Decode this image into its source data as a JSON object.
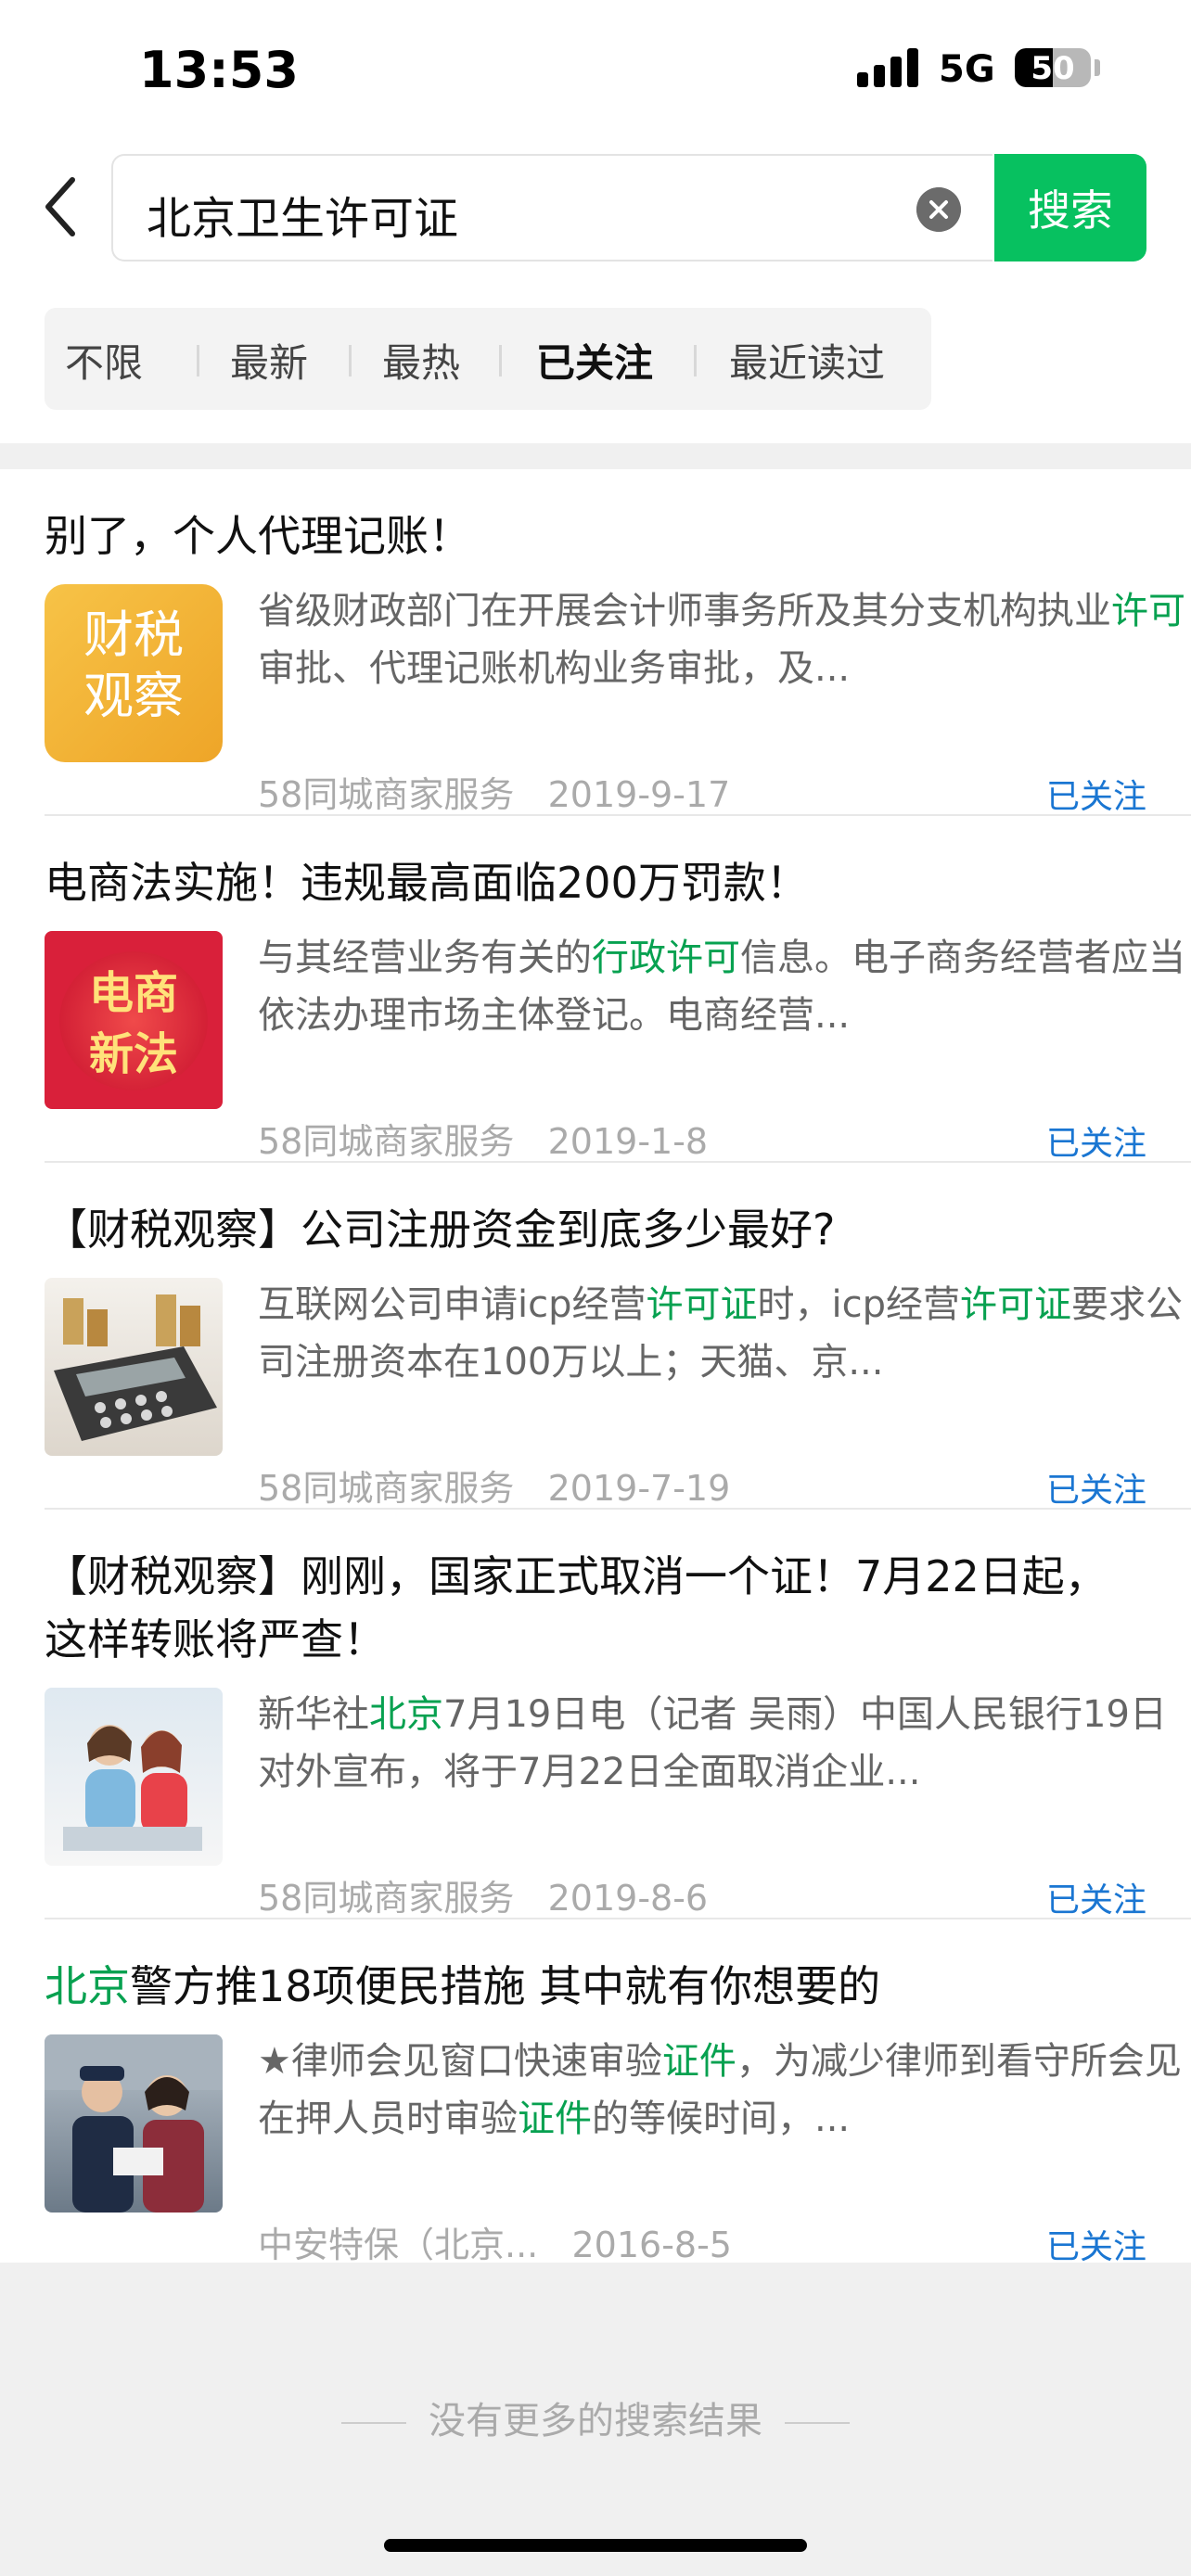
{
  "status_bar": {
    "time": "13:53",
    "network": "5G",
    "battery": "50",
    "battery_level": 0.5
  },
  "search": {
    "query": "北京卫生许可证",
    "button_label": "搜索"
  },
  "filters": [
    "不限",
    "最新",
    "最热",
    "已关注",
    "最近读过"
  ],
  "active_filter": "已关注",
  "results": [
    {
      "title_parts": [
        {
          "text": "别了，个人代理记账！",
          "hl": false
        }
      ],
      "thumb_text": [
        "财税",
        "观察"
      ],
      "snippet_parts": [
        {
          "text": "省级财政部门在开展会计师事务所及其分支机构执业",
          "hl": false
        },
        {
          "text": "许可",
          "hl": true
        },
        {
          "text": "审批、代理记账机构业务审批，及...",
          "hl": false
        }
      ],
      "source": "58同城商家服务",
      "date": "2019-9-17",
      "follow_label": "已关注"
    },
    {
      "title_parts": [
        {
          "text": "电商法实施！违规最高面临200万罚款！",
          "hl": false
        }
      ],
      "thumb_text": [
        "电商",
        "新法"
      ],
      "snippet_parts": [
        {
          "text": "与其经营业务有关的",
          "hl": false
        },
        {
          "text": "行政许可",
          "hl": true
        },
        {
          "text": "信息。电子商务经营者应当依法办理市场主体登记。电商经营...",
          "hl": false
        }
      ],
      "source": "58同城商家服务",
      "date": "2019-1-8",
      "follow_label": "已关注"
    },
    {
      "title_parts": [
        {
          "text": "【财税观察】公司注册资金到底多少最好?",
          "hl": false
        }
      ],
      "thumb_text": [],
      "snippet_parts": [
        {
          "text": "互联网公司申请icp经营",
          "hl": false
        },
        {
          "text": "许可证",
          "hl": true
        },
        {
          "text": "时，icp经营",
          "hl": false
        },
        {
          "text": "许可证",
          "hl": true
        },
        {
          "text": "要求公司注册资本在100万以上；天猫、京...",
          "hl": false
        }
      ],
      "source": "58同城商家服务",
      "date": "2019-7-19",
      "follow_label": "已关注"
    },
    {
      "title_parts": [
        {
          "text": "【财税观察】刚刚，国家正式取消一个证！7月22日起，这样转账将严查！",
          "hl": false
        }
      ],
      "thumb_text": [],
      "snippet_parts": [
        {
          "text": "新华社",
          "hl": false
        },
        {
          "text": "北京",
          "hl": true
        },
        {
          "text": "7月19日电（记者 吴雨）中国人民银行19日对外宣布，将于7月22日全面取消企业...",
          "hl": false
        }
      ],
      "source": "58同城商家服务",
      "date": "2019-8-6",
      "follow_label": "已关注"
    },
    {
      "title_parts": [
        {
          "text": "北京",
          "hl": true
        },
        {
          "text": "警方推18项便民措施 其中就有你想要的",
          "hl": false
        }
      ],
      "thumb_text": [],
      "snippet_parts": [
        {
          "text": "★律师会见窗口快速审验",
          "hl": false
        },
        {
          "text": "证件",
          "hl": true
        },
        {
          "text": "，为减少律师到看守所会见在押人员时审验",
          "hl": false
        },
        {
          "text": "证件",
          "hl": true
        },
        {
          "text": "的等候时间，...",
          "hl": false
        }
      ],
      "source": "中安特保（北京...",
      "date": "2016-8-5",
      "follow_label": "已关注"
    }
  ],
  "end_text": "没有更多的搜索结果",
  "colors": {
    "accent": "#07c160",
    "highlight": "#07a150",
    "link": "#1a76d2"
  }
}
